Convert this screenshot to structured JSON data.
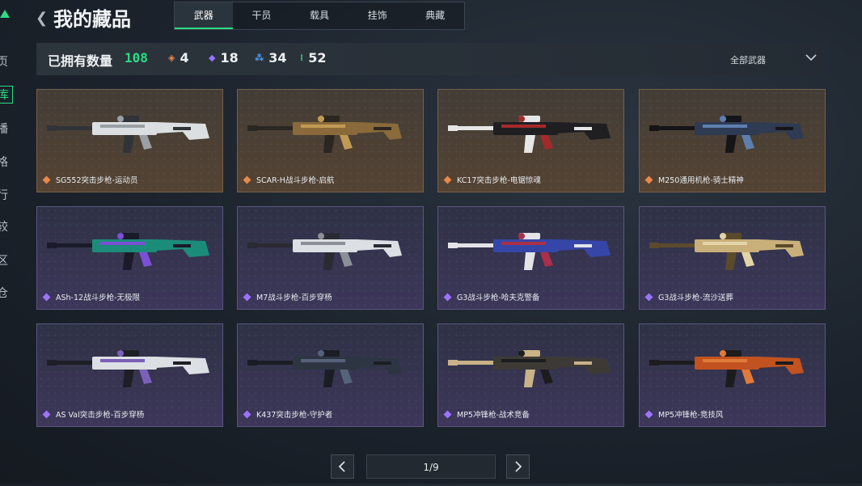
{
  "leftnav": {
    "items": [
      {
        "char": "页"
      },
      {
        "char": "库",
        "active": true
      },
      {
        "char": "播"
      },
      {
        "char": "格"
      },
      {
        "char": "行"
      },
      {
        "char": "较"
      },
      {
        "char": "区"
      },
      {
        "char": "仓"
      }
    ]
  },
  "header": {
    "back_icon": "chevron-left-icon",
    "title": "我的藏品",
    "tabs": [
      {
        "label": "武器",
        "active": true
      },
      {
        "label": "干员"
      },
      {
        "label": "载具"
      },
      {
        "label": "挂饰"
      },
      {
        "label": "典藏"
      }
    ]
  },
  "stats": {
    "owned_label": "已拥有数量",
    "owned_count": "108",
    "rarities": [
      {
        "icon": "orange-diamond-icon",
        "color": "#e8894a",
        "count": "4"
      },
      {
        "icon": "purple-diamond-icon",
        "color": "#9a74ff",
        "count": "18"
      },
      {
        "icon": "blue-triple-icon",
        "color": "#4aa3ff",
        "count": "34"
      },
      {
        "icon": "green-dots-icon",
        "color": "#2bdc86",
        "count": "52"
      }
    ],
    "filter_label": "全部武器",
    "filter_icon": "chevron-down-icon"
  },
  "cards": [
    {
      "name": "SG552突击步枪-运动员",
      "rarity": "orange",
      "palette": [
        "#dcdfe1",
        "#303438",
        "#9aa0a5"
      ]
    },
    {
      "name": "SCAR-H战斗步枪-启航",
      "rarity": "orange",
      "palette": [
        "#8a6a3a",
        "#2b2620",
        "#c29a55"
      ]
    },
    {
      "name": "KC17突击步枪-电锯惊魂",
      "rarity": "orange",
      "palette": [
        "#1f1f22",
        "#e6e6e6",
        "#a32a2a"
      ]
    },
    {
      "name": "M250通用机枪-骑士精神",
      "rarity": "orange",
      "palette": [
        "#2f3b52",
        "#151518",
        "#5d7fb0"
      ]
    },
    {
      "name": "ASh-12战斗步枪-无极限",
      "rarity": "purple",
      "palette": [
        "#1c8c7a",
        "#1a1a2a",
        "#7b4fd6"
      ]
    },
    {
      "name": "M7战斗步枪-百步穿杨",
      "rarity": "purple",
      "palette": [
        "#dcdfe3",
        "#2a2a33",
        "#8c8f98"
      ]
    },
    {
      "name": "G3战斗步枪-哈夫克警备",
      "rarity": "purple",
      "palette": [
        "#3646a8",
        "#e3e3e8",
        "#a8304a"
      ]
    },
    {
      "name": "G3战斗步枪-流沙送葬",
      "rarity": "purple",
      "palette": [
        "#c9b07a",
        "#5b4a2c",
        "#e3d4a8"
      ]
    },
    {
      "name": "AS Val突击步枪-百步穿杨",
      "rarity": "purple",
      "palette": [
        "#dcdfe3",
        "#1e1e26",
        "#7b5fb8"
      ]
    },
    {
      "name": "K437突击步枪-守护者",
      "rarity": "purple",
      "palette": [
        "#2e3542",
        "#1a1d24",
        "#56627a"
      ]
    },
    {
      "name": "MP5冲锋枪-战术竞备",
      "rarity": "purple",
      "palette": [
        "#3d3a36",
        "#c9b287",
        "#1c1c1e"
      ]
    },
    {
      "name": "MP5冲锋枪-竞技风",
      "rarity": "purple",
      "palette": [
        "#c2521f",
        "#1c1c1e",
        "#e07a3a"
      ]
    }
  ],
  "pager": {
    "prev_icon": "chevron-left-icon",
    "next_icon": "chevron-right-icon",
    "page_text": "1/9"
  }
}
